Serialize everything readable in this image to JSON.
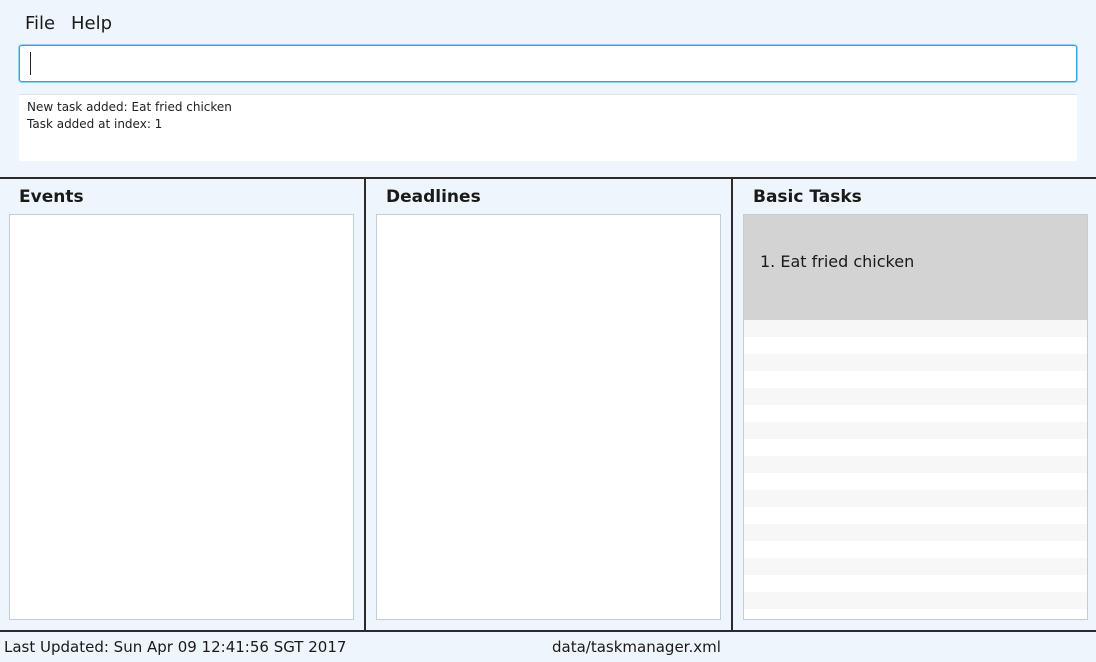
{
  "menu": {
    "items": [
      {
        "label": "File"
      },
      {
        "label": "Help"
      }
    ]
  },
  "command": {
    "value": "",
    "placeholder": ""
  },
  "result": {
    "lines": [
      "New task added: Eat fried chicken",
      "Task added at index: 1"
    ]
  },
  "panels": {
    "events": {
      "title": "Events",
      "items": []
    },
    "deadlines": {
      "title": "Deadlines",
      "items": []
    },
    "basic": {
      "title": "Basic Tasks",
      "items": [
        {
          "index": "1.",
          "text": "Eat fried chicken",
          "display": "1. Eat fried chicken"
        }
      ]
    }
  },
  "status": {
    "last_updated": "Last Updated: Sun Apr 09 12:41:56 SGT 2017",
    "file_path": "data/taskmanager.xml"
  },
  "colors": {
    "background": "#eef5fc",
    "input_focus": "#2aa8d8",
    "selected_cell": "#d3d3d3",
    "divider": "#2b2b2b"
  }
}
